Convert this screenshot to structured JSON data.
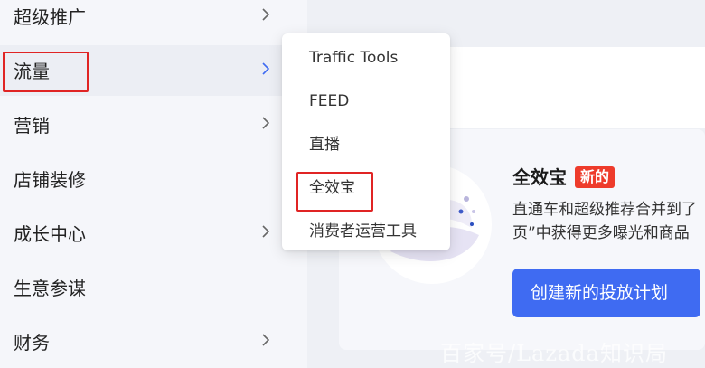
{
  "sidebar": {
    "items": [
      {
        "label": "超级推广",
        "has_chevron": true,
        "chevron_color": "#666666"
      },
      {
        "label": "流量",
        "has_chevron": true,
        "chevron_color": "#3f6bf2",
        "active": true
      },
      {
        "label": "营销",
        "has_chevron": true,
        "chevron_color": "#666666"
      },
      {
        "label": "店铺装修",
        "has_chevron": false
      },
      {
        "label": "成长中心",
        "has_chevron": true,
        "chevron_color": "#666666"
      },
      {
        "label": "生意参谋",
        "has_chevron": false
      },
      {
        "label": "财务",
        "has_chevron": true,
        "chevron_color": "#666666"
      }
    ]
  },
  "submenu": {
    "items": [
      {
        "label": "Traffic Tools"
      },
      {
        "label": "FEED"
      },
      {
        "label": "直播"
      },
      {
        "label": "全效宝"
      },
      {
        "label": "消费者运营工具"
      }
    ]
  },
  "card": {
    "title": "全效宝",
    "badge": "新的",
    "desc_line1": "直通车和超级推荐合并到了",
    "desc_line2": "页”中获得更多曝光和商品",
    "button_label": "创建新的投放计划"
  },
  "watermark": "百家号/Lazada知识局",
  "colors": {
    "accent": "#3f6bf2",
    "badge": "#ee3b2b",
    "highlight": "#e02424"
  },
  "icons": {
    "chevron": "chevron-right-icon",
    "illustration": "planet-illustration-icon"
  }
}
